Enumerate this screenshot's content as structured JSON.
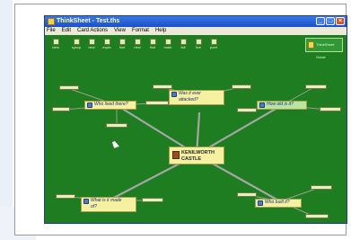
{
  "window": {
    "title": "ThinkSheet - Test.ths"
  },
  "menubar": {
    "items": [
      "File",
      "Edit",
      "Card Actions",
      "View",
      "Format",
      "Help"
    ]
  },
  "toolbar": {
    "items": [
      {
        "label": "view",
        "icon": "view-icon"
      },
      {
        "label": "syscp",
        "icon": "syscp-icon"
      },
      {
        "label": "new",
        "icon": "new-icon"
      },
      {
        "label": "expln",
        "icon": "expln-icon"
      },
      {
        "label": "hint",
        "icon": "hint-icon"
      },
      {
        "label": "new",
        "icon": "new-card-icon"
      },
      {
        "label": "find",
        "icon": "find-icon"
      },
      {
        "label": "mark",
        "icon": "mark-icon"
      },
      {
        "label": "fall",
        "icon": "fall-icon"
      },
      {
        "label": "live",
        "icon": "live-icon"
      },
      {
        "label": "pure",
        "icon": "pure-icon"
      }
    ]
  },
  "quick_panel": {
    "label": "ThinkSheet Guide"
  },
  "map": {
    "center": {
      "line1": "KENILWORTH",
      "line2": "CASTLE"
    },
    "nodes": [
      {
        "id": "who-lived",
        "label": "Who lived there?"
      },
      {
        "id": "attacked",
        "line1": "Was it ever",
        "line2": "attacked?"
      },
      {
        "id": "how-old",
        "label": "How old is it?"
      },
      {
        "id": "made-of",
        "line1": "What is it made",
        "line2": "of?"
      },
      {
        "id": "who-built",
        "label": "Who built it?"
      }
    ]
  },
  "colors": {
    "canvas": "#1d7d20",
    "node": "#f6f1a0",
    "title_bar": "#1b4fc8"
  }
}
